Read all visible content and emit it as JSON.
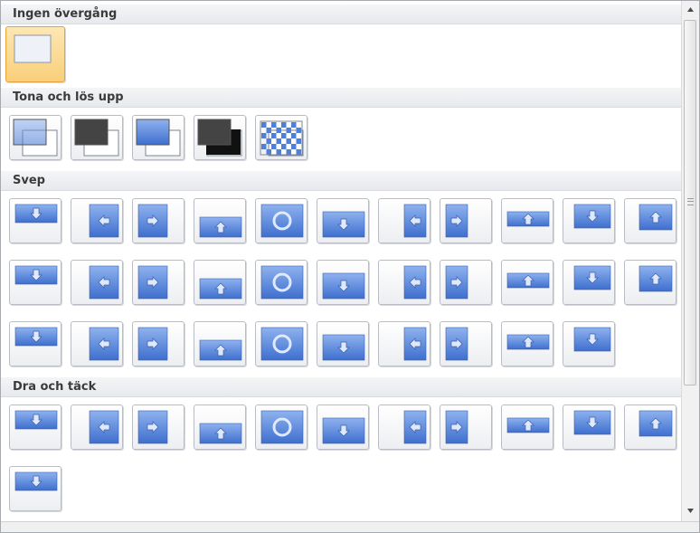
{
  "sections": {
    "none": "Ingen övergång",
    "fade": "Tona och lös upp",
    "wipe": "Svep",
    "push": "Dra och täck"
  },
  "colors": {
    "accent_blue": "#4f7fd8",
    "selected_tile": "#f9cf7a",
    "header_bg": "#ebedf0"
  },
  "groups": [
    {
      "key": "none",
      "count": 1,
      "selected_index": 0
    },
    {
      "key": "fade",
      "count": 5
    },
    {
      "key": "wipe",
      "count": 32
    },
    {
      "key": "push",
      "count": 12
    }
  ],
  "scrollbar": {
    "up_icon": "triangle-up-icon",
    "down_icon": "triangle-down-icon"
  }
}
